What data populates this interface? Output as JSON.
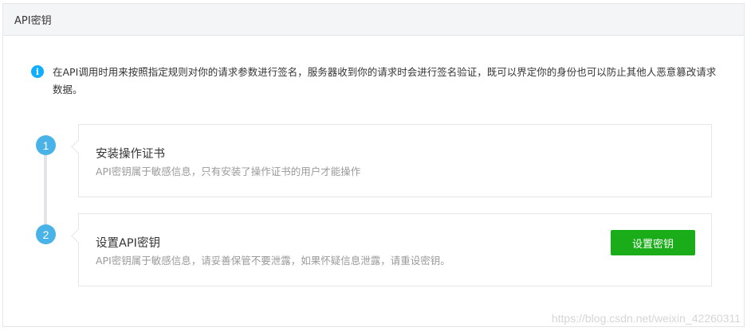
{
  "panel": {
    "title": "API密钥"
  },
  "notice": {
    "icon": "info-icon",
    "icon_glyph": "i",
    "text": "在API调用时用来按照指定规则对你的请求参数进行签名，服务器收到你的请求时会进行签名验证，既可以界定你的身份也可以防止其他人恶意篡改请求数据。"
  },
  "steps": [
    {
      "number": "1",
      "title": "安装操作证书",
      "description": "API密钥属于敏感信息，只有安装了操作证书的用户才能操作"
    },
    {
      "number": "2",
      "title": "设置API密钥",
      "description": "API密钥属于敏感信息，请妥善保管不要泄露，如果怀疑信息泄露，请重设密钥。",
      "button_label": "设置密钥"
    }
  ],
  "watermark": "https://blog.csdn.net/weixin_42260311",
  "colors": {
    "accent_blue": "#10aeff",
    "step_blue": "#49b3e7",
    "button_green": "#1aad19"
  }
}
